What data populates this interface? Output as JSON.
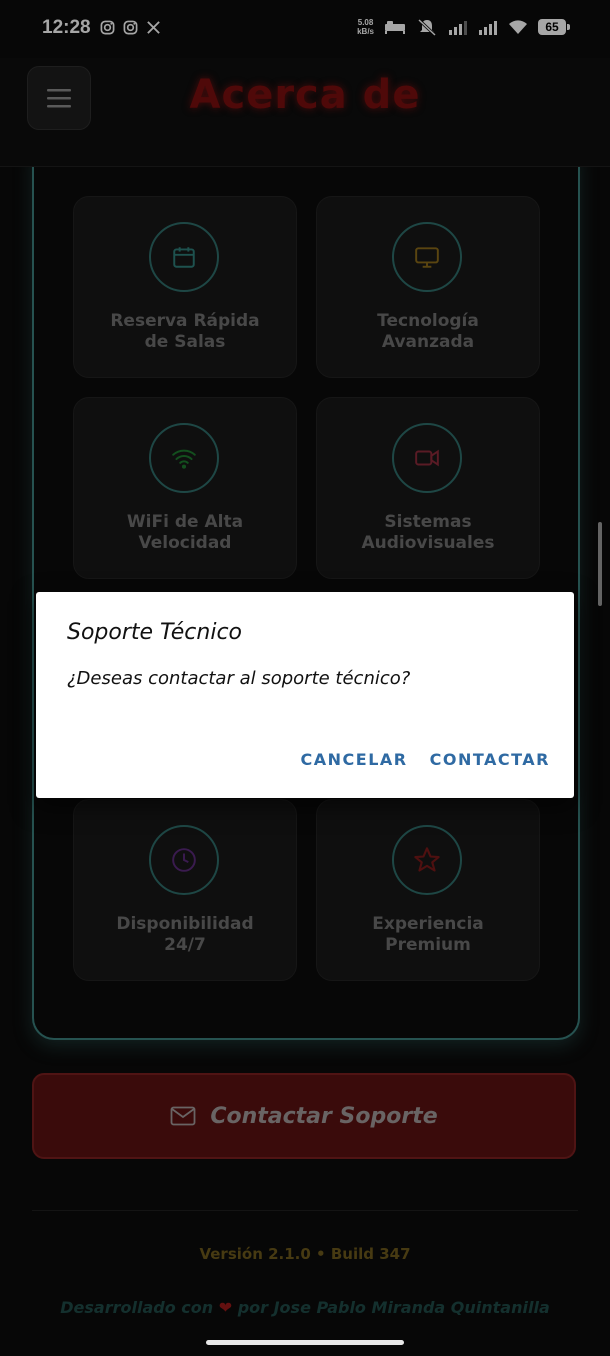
{
  "status_bar": {
    "time": "12:28",
    "net_speed_value": "5.08",
    "net_speed_unit": "kB/s",
    "battery": "65"
  },
  "header": {
    "title": "Acerca de"
  },
  "features": [
    {
      "label": "Reserva Rápida\nde Salas",
      "icon": "calendar-icon",
      "color": "#2e7f7a"
    },
    {
      "label": "Tecnología\nAvanzada",
      "icon": "monitor-icon",
      "color": "#8a6a1a"
    },
    {
      "label": "WiFi de Alta\nVelocidad",
      "icon": "wifi-icon",
      "color": "#1e7a2e"
    },
    {
      "label": "Sistemas\nAudiovisuales",
      "icon": "video-icon",
      "color": "#8a2a3a"
    },
    {
      "label": "Disponibilidad\n24/7",
      "icon": "clock-icon",
      "color": "#5a2a7a"
    },
    {
      "label": "Experiencia\nPremium",
      "icon": "star-icon",
      "color": "#7a1a1a"
    }
  ],
  "dialog": {
    "title": "Soporte Técnico",
    "message": "¿Deseas contactar al soporte técnico?",
    "cancel_label": "CANCELAR",
    "confirm_label": "CONTACTAR"
  },
  "contact_button": {
    "label": "Contactar Soporte"
  },
  "footer": {
    "version": "Versión 2.1.0 • Build 347",
    "credits_prefix": "Desarrollado con",
    "credits_suffix": "por Jose Pablo Miranda Quintanilla"
  },
  "colors": {
    "accent_teal": "#3b7f7c",
    "header_red": "#7a0e0e",
    "dialog_button_blue": "#2f6aa3"
  }
}
